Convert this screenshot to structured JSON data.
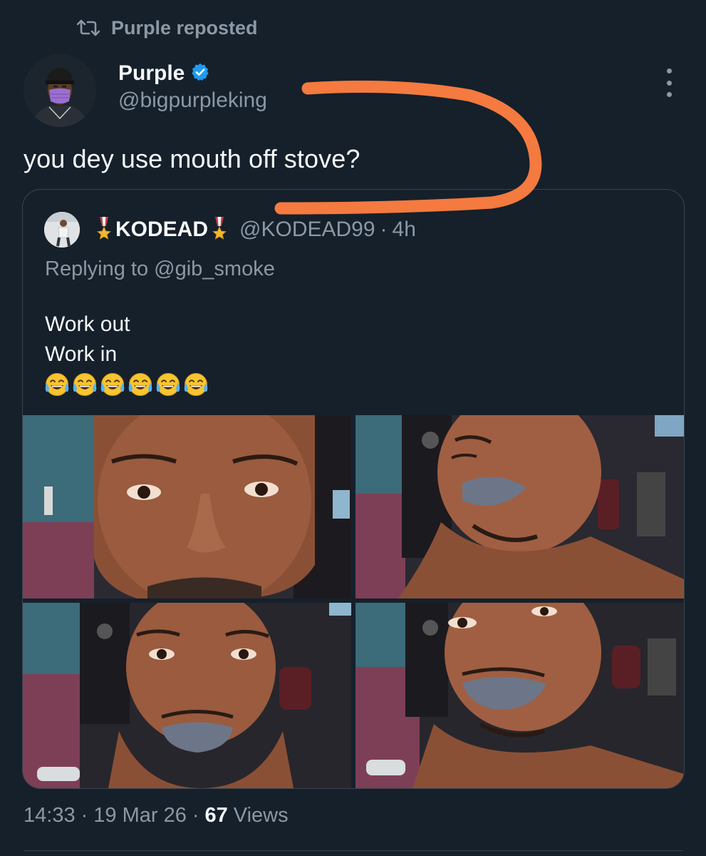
{
  "repost": {
    "icon": "repost-icon",
    "text": "Purple reposted"
  },
  "author": {
    "name": "Purple",
    "handle": "@bigpurpleking",
    "verified_icon": "verified-badge-icon",
    "verified_color": "#1d9bf0"
  },
  "tweet": {
    "text": "you dey use mouth off stove?"
  },
  "quoted": {
    "name": "KODEAD",
    "name_decoration_icon": "military-medal-icon",
    "handle": "@KODEAD99",
    "separator": "·",
    "time": "4h",
    "replying_prefix": "Replying to ",
    "replying_handle": "@gib_smoke",
    "lines": [
      "Work out",
      "Work in"
    ],
    "emoji": "😂😂😂😂😂😂",
    "media_count": 4
  },
  "footer": {
    "time": "14:33",
    "sep1": "·",
    "date": "19 Mar 26",
    "sep2": "·",
    "views_count": "67",
    "views_label": "Views"
  },
  "colors": {
    "background": "#15202b",
    "text_primary": "#f7f9f9",
    "text_secondary": "#8b98a5",
    "border": "#38444d",
    "annotation_stroke": "#f47a3f"
  }
}
